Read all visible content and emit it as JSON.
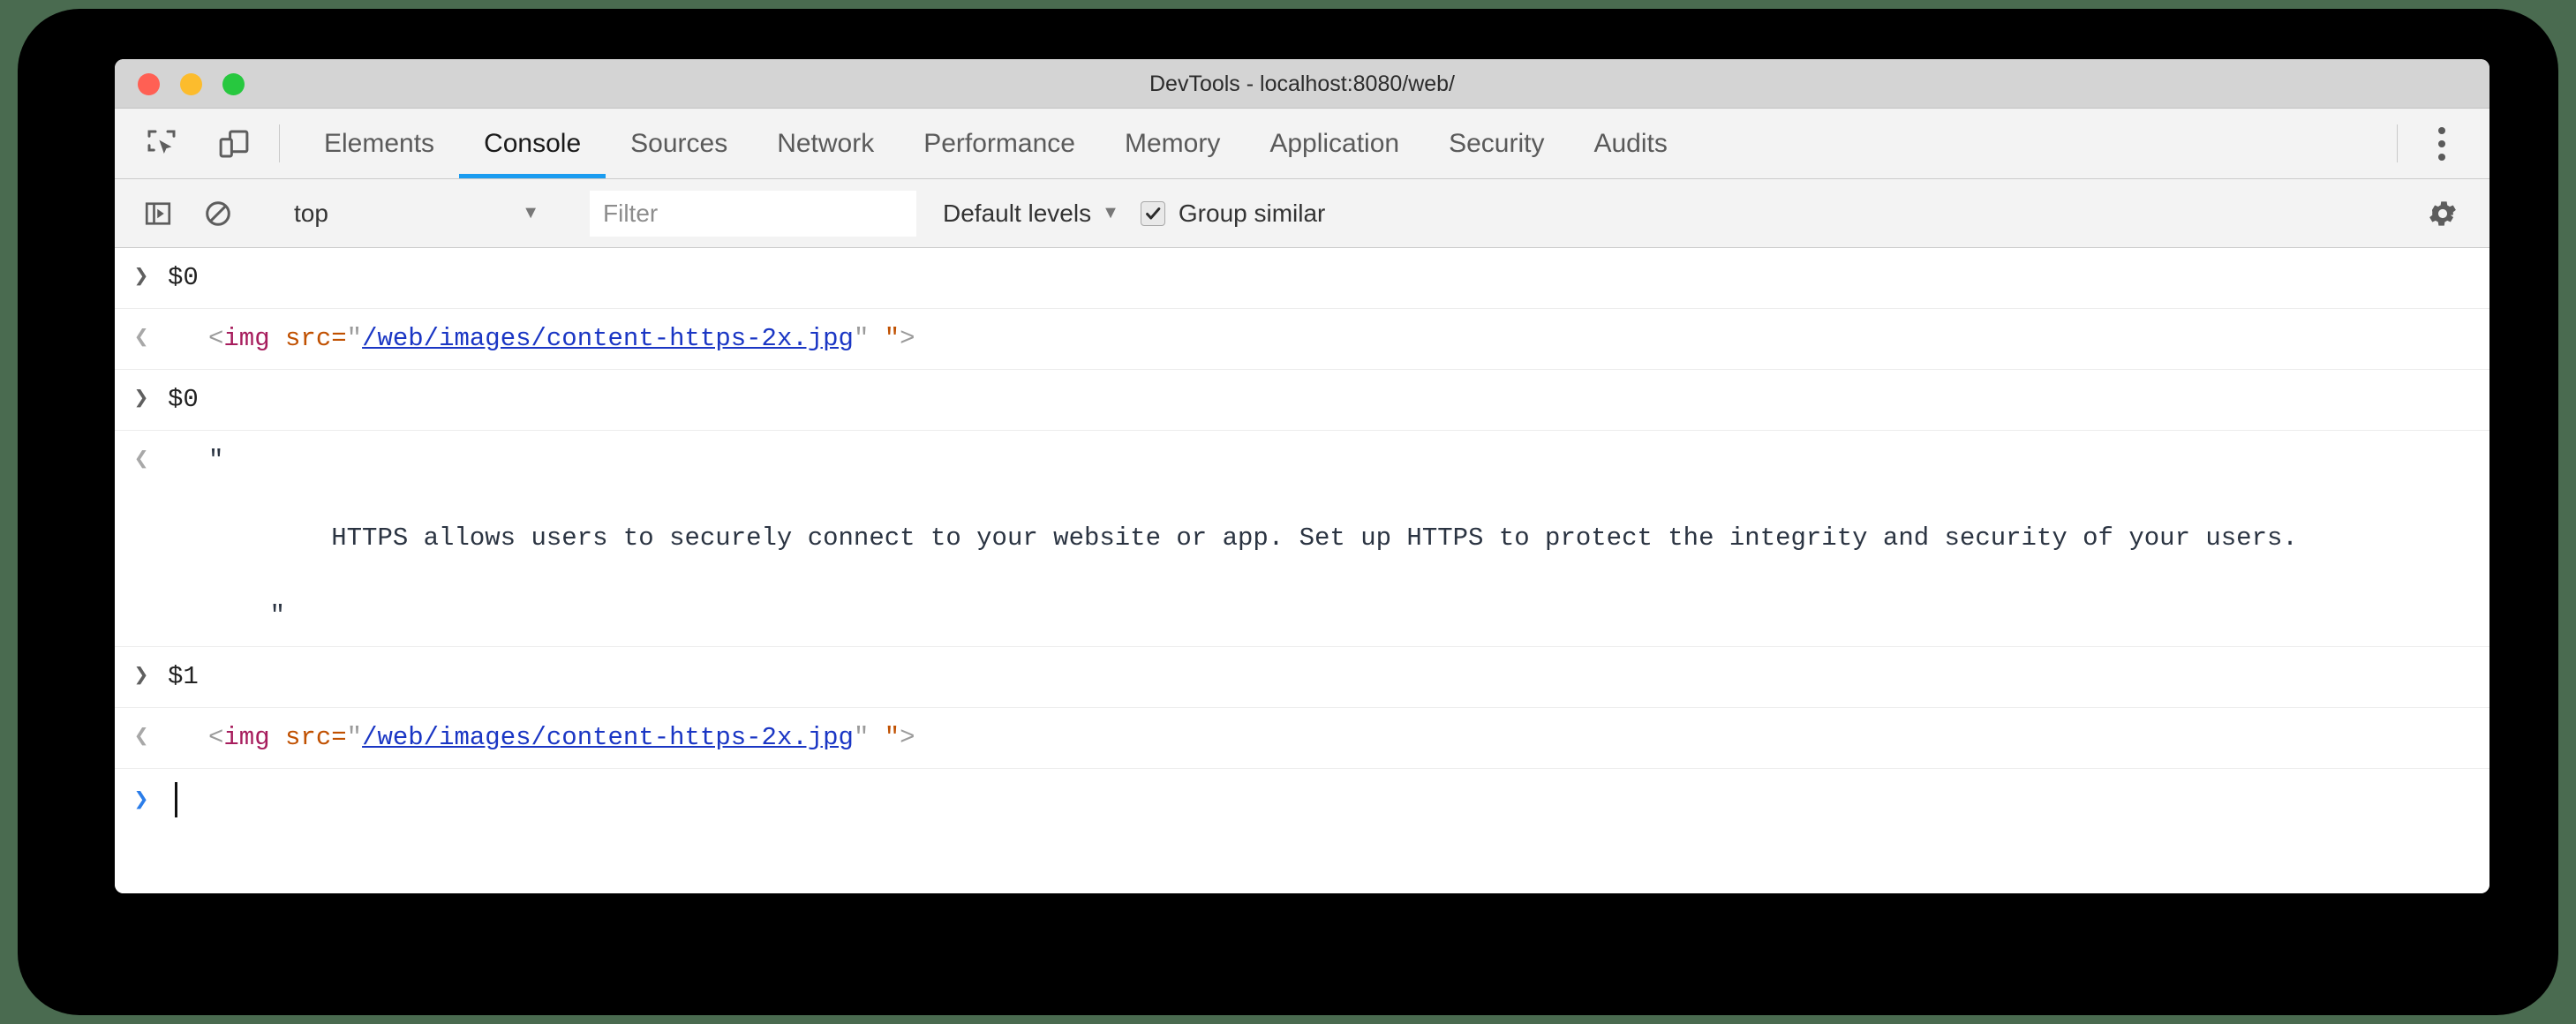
{
  "window": {
    "title": "DevTools - localhost:8080/web/",
    "traffic_lights": [
      {
        "name": "close",
        "color": "#ff6054"
      },
      {
        "name": "minimize",
        "color": "#fcbc2d"
      },
      {
        "name": "maximize",
        "color": "#27c83f"
      }
    ]
  },
  "toolbar_icons": {
    "inspect": "inspect-element-icon",
    "device": "device-toolbar-icon",
    "kebab": "more-options-icon"
  },
  "tabs": [
    {
      "label": "Elements",
      "active": false
    },
    {
      "label": "Console",
      "active": true
    },
    {
      "label": "Sources",
      "active": false
    },
    {
      "label": "Network",
      "active": false
    },
    {
      "label": "Performance",
      "active": false
    },
    {
      "label": "Memory",
      "active": false
    },
    {
      "label": "Application",
      "active": false
    },
    {
      "label": "Security",
      "active": false
    },
    {
      "label": "Audits",
      "active": false
    }
  ],
  "console_toolbar": {
    "sidebar_toggle_icon": "console-sidebar-icon",
    "clear_icon": "clear-console-icon",
    "context": {
      "value": "top",
      "caret": "▼"
    },
    "filter": {
      "value": "",
      "placeholder": "Filter"
    },
    "levels": {
      "label": "Default levels",
      "caret": "▼"
    },
    "group_similar": {
      "label": "Group similar",
      "checked": true
    },
    "settings_icon": "gear-icon"
  },
  "console_messages": [
    {
      "type": "input",
      "gutter": "❯",
      "text": "$0"
    },
    {
      "type": "output",
      "gutter": "❮",
      "html_result": {
        "open_bracket": "<",
        "tag": "img",
        "space": " ",
        "attr": "src=",
        "quote_open": "\"",
        "link": "/web/images/content-https-2x.jpg",
        "quote_close": "\"",
        "gap": " ",
        "quote_orange": "\"",
        "close_bracket": ">"
      }
    },
    {
      "type": "input",
      "gutter": "❯",
      "text": "$0"
    },
    {
      "type": "output",
      "gutter": "❮",
      "text": "\"\n\n        HTTPS allows users to securely connect to your website or app. Set up HTTPS to protect the integrity and security of your users.\n\n    \""
    },
    {
      "type": "input",
      "gutter": "❯",
      "text": "$1"
    },
    {
      "type": "output",
      "gutter": "❮",
      "html_result": {
        "open_bracket": "<",
        "tag": "img",
        "space": " ",
        "attr": "src=",
        "quote_open": "\"",
        "link": "/web/images/content-https-2x.jpg",
        "quote_close": "\"",
        "gap": " ",
        "quote_orange": "\"",
        "close_bracket": ">"
      }
    }
  ],
  "prompt": {
    "gutter": "❯",
    "value": ""
  },
  "colors": {
    "accent": "#1a9cf0",
    "prompt_chevron": "#2b7de9",
    "tag": "#a71d5d",
    "attribute": "#c05000",
    "link": "#1a36c4",
    "background_desktop": "#4a6b50",
    "frame": "#000000",
    "titlebar": "#d4d4d4",
    "toolbar": "#f3f3f3"
  }
}
